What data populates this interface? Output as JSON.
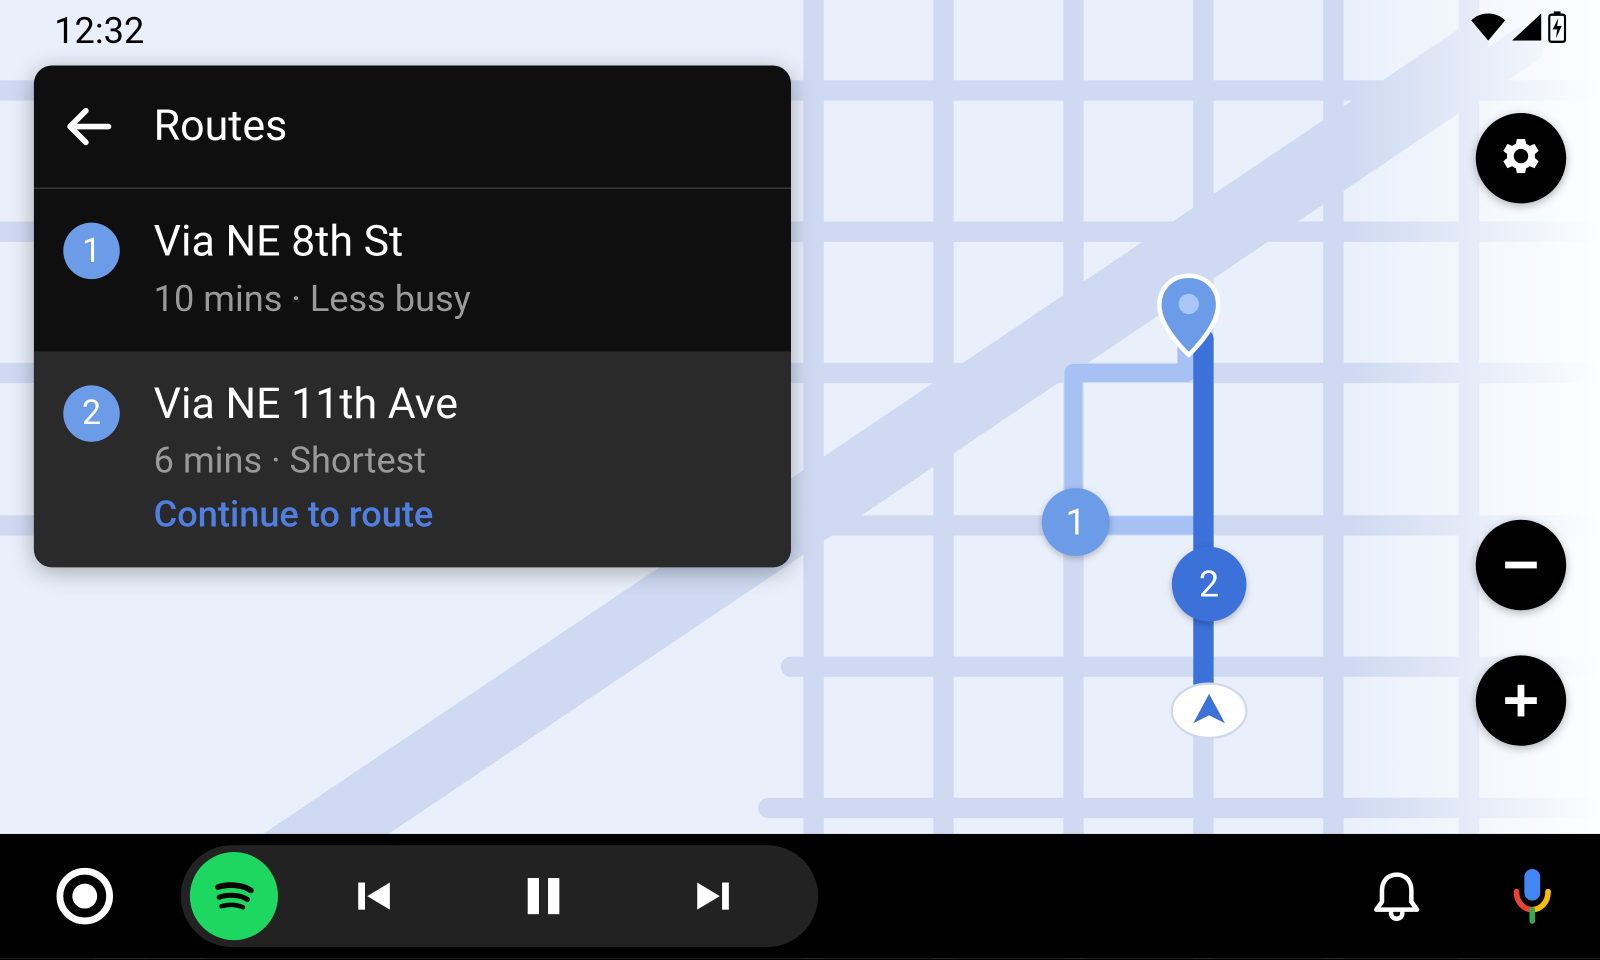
{
  "statusbar": {
    "time": "12:32"
  },
  "routes_panel": {
    "title": "Routes",
    "items": [
      {
        "num": "1",
        "name": "Via NE 8th St",
        "subtitle": "10 mins · Less busy",
        "action": ""
      },
      {
        "num": "2",
        "name": "Via NE 11th Ave",
        "subtitle": "6 mins · Shortest",
        "action": "Continue to route"
      }
    ]
  },
  "map": {
    "marker1": "1",
    "marker2": "2"
  },
  "colors": {
    "accent": "#4f7fe0",
    "badge_light": "#6c9ce8",
    "badge_dark": "#3b71d8",
    "spotify": "#1ed760"
  }
}
